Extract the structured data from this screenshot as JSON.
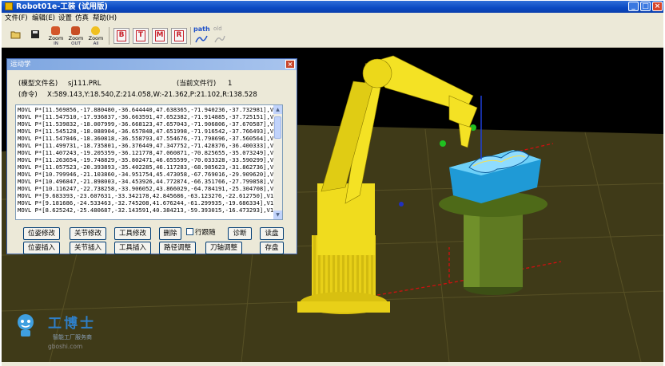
{
  "window": {
    "title": "Robot01e-工装 (试用版)"
  },
  "menu": [
    "文件(F)",
    "编辑(E)",
    "设置",
    "仿真",
    "帮助(H)"
  ],
  "toolbar": {
    "zoom_in": {
      "label": "Zoom",
      "sub": "IN"
    },
    "zoom_out": {
      "label": "Zoom",
      "sub": "OUT"
    },
    "zoom_all": {
      "label": "Zoom",
      "sub": "All"
    },
    "view_buttons": [
      "B",
      "T",
      "M",
      "R"
    ],
    "path_label": "path",
    "old_label": "old"
  },
  "dialog": {
    "title": "运动学",
    "model_file_label": "(模型文件名)",
    "model_file_value": "sj111.PRL",
    "current_file_line_label": "(当前文件行)",
    "current_file_line_value": "1",
    "command_label": "(命令)",
    "command_value": "X:589.143,Y:18.540,Z:214.058,W:-21.362,P:21.102,R:138.528",
    "lines": [
      "MOVL P*[11.569856,-17.880480,-36.644440,47.638365,-71.940236,-37.732981],V1",
      "MOVL P*[11.547510,-17.936837,-36.663591,47.652382,-71.914885,-37.725151],V1",
      "MOVL P*[11.539832,-18.007999,-36.668123,47.657043,-71.906806,-37.670587],V1",
      "MOVL P*[11.545128,-18.088904,-36.657848,47.651998,-71.916542,-37.766493],V1",
      "MOVL P*[11.547846,-18.360818,-36.558793,47.554676,-71.798696,-37.560564],V1",
      "MOVL P*[11.499731,-18.735801,-36.376449,47.347752,-71.428376,-36.400333],V1",
      "MOVL P*[11.407243,-19.205359,-36.121778,47.060871,-70.825655,-35.073249],V1",
      "MOVL P*[11.263654,-19.748829,-35.802471,46.655599,-70.033328,-33.590299],V1",
      "MOVL P*[11.057523,-20.393893,-35.402285,46.117283,-68.985623,-31.862736],V1",
      "MOVL P*[10.799946,-21.103860,-34.951754,45.473058,-67.769016,-29.909620],V1",
      "MOVL P*[10.496847,-21.898003,-34.453926,44.772874,-66.351766,-27.799858],V1",
      "MOVL P*[10.116247,-22.738258,-33.906052,43.866029,-64.784191,-25.304708],V1",
      "MOVL P*[9.683393,-23.607631,-33.342178,42.845686,-63.123276,-22.612750],V10",
      "MOVL P*[9.181686,-24.533463,-32.745208,41.676244,-61.299935,-19.686334],V10",
      "MOVL P*[8.625242,-25.480687,-32.143591,40.384213,-59.393015,-16.473293],V10"
    ],
    "buttons_row1": [
      "位姿修改",
      "关节修改",
      "工具修改",
      "删除"
    ],
    "checkbox_label": "行跟随",
    "buttons_row1_b": [
      "诊断",
      "读盘"
    ],
    "buttons_row2": [
      "位姿插入",
      "关节插入",
      "工具插入",
      "路径调整",
      "刀轴调整",
      "存盘"
    ]
  },
  "watermark": {
    "title": "工博士",
    "subtitle": "智能工厂服务商",
    "url": "gboshi.com"
  },
  "colors": {
    "robot_yellow": "#f2e020",
    "workpiece_blue": "#36b6ee",
    "column_green": "#5f7a22",
    "floor": "#3f3a18",
    "title_blue": "#0a49c2"
  }
}
